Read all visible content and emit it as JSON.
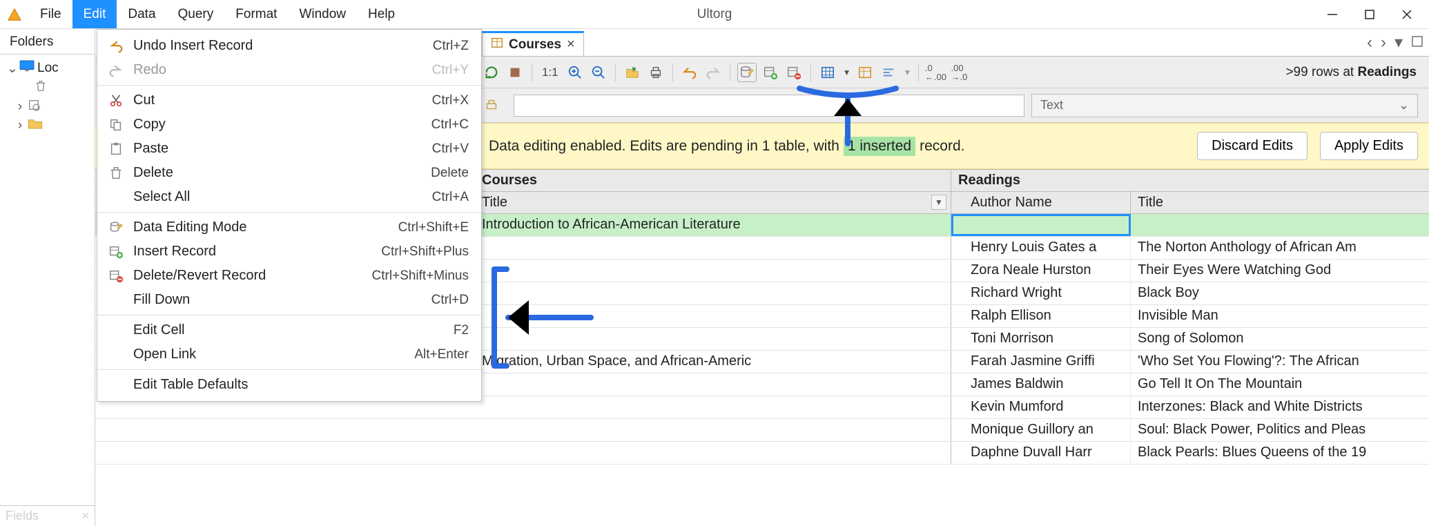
{
  "app": {
    "title": "Ultorg"
  },
  "menubar": [
    "File",
    "Edit",
    "Data",
    "Query",
    "Format",
    "Window",
    "Help"
  ],
  "active_menu_index": 1,
  "sidebar": {
    "header": "Folders",
    "root_label": "Loc",
    "footer_label": "Fields"
  },
  "edit_menu": {
    "groups": [
      [
        {
          "label": "Undo Insert Record",
          "shortcut": "Ctrl+Z",
          "icon": "undo",
          "disabled": false
        },
        {
          "label": "Redo",
          "shortcut": "Ctrl+Y",
          "icon": "redo",
          "disabled": true
        }
      ],
      [
        {
          "label": "Cut",
          "shortcut": "Ctrl+X",
          "icon": "cut"
        },
        {
          "label": "Copy",
          "shortcut": "Ctrl+C",
          "icon": "copy"
        },
        {
          "label": "Paste",
          "shortcut": "Ctrl+V",
          "icon": "paste"
        },
        {
          "label": "Delete",
          "shortcut": "Delete",
          "icon": "delete"
        },
        {
          "label": "Select All",
          "shortcut": "Ctrl+A"
        }
      ],
      [
        {
          "label": "Data Editing Mode",
          "shortcut": "Ctrl+Shift+E",
          "icon": "dbedit"
        },
        {
          "label": "Insert Record",
          "shortcut": "Ctrl+Shift+Plus",
          "icon": "insert"
        },
        {
          "label": "Delete/Revert Record",
          "shortcut": "Ctrl+Shift+Minus",
          "icon": "delrec"
        },
        {
          "label": "Fill Down",
          "shortcut": "Ctrl+D"
        }
      ],
      [
        {
          "label": "Edit Cell",
          "shortcut": "F2"
        },
        {
          "label": "Open Link",
          "shortcut": "Alt+Enter"
        }
      ],
      [
        {
          "label": "Edit Table Defaults"
        }
      ]
    ]
  },
  "tab": {
    "label": "Courses"
  },
  "toolbar": {
    "ratio": "1:1",
    "row_status_prefix": ">99 rows at ",
    "row_status_target": "Readings"
  },
  "type_selector": {
    "label": "Text"
  },
  "notice": {
    "text_before": "Data editing enabled. Edits are pending in 1 table, with ",
    "highlight": "1 inserted",
    "text_after": " record.",
    "discard": "Discard Edits",
    "apply": "Apply Edits"
  },
  "grid": {
    "super_left": "Courses",
    "super_right": "Readings",
    "col_left": "Title",
    "col_author": "Author Name",
    "col_title2": "Title",
    "rows": [
      {
        "title": "Introduction to African-American Literature",
        "readings": [
          {
            "author": "",
            "title": "",
            "inserted": true
          },
          {
            "author": "Henry Louis Gates a",
            "title": "The Norton Anthology of African Am"
          },
          {
            "author": "Zora Neale Hurston",
            "title": "Their Eyes Were Watching God"
          },
          {
            "author": "Richard Wright",
            "title": "Black Boy"
          },
          {
            "author": "Ralph Ellison",
            "title": "Invisible Man"
          },
          {
            "author": "Toni Morrison",
            "title": "Song of Solomon"
          }
        ]
      },
      {
        "title": "Migration, Urban Space, and African-Americ",
        "readings": [
          {
            "author": "Farah Jasmine Griffi",
            "title": "'Who Set You Flowing'?: The African"
          },
          {
            "author": "James Baldwin",
            "title": "Go Tell It On The Mountain"
          },
          {
            "author": "Kevin Mumford",
            "title": "Interzones: Black and White Districts"
          },
          {
            "author": "Monique Guillory an",
            "title": "Soul: Black Power, Politics and Pleas"
          },
          {
            "author": "Daphne Duvall Harr",
            "title": "Black Pearls: Blues Queens of the 19"
          }
        ]
      }
    ]
  }
}
